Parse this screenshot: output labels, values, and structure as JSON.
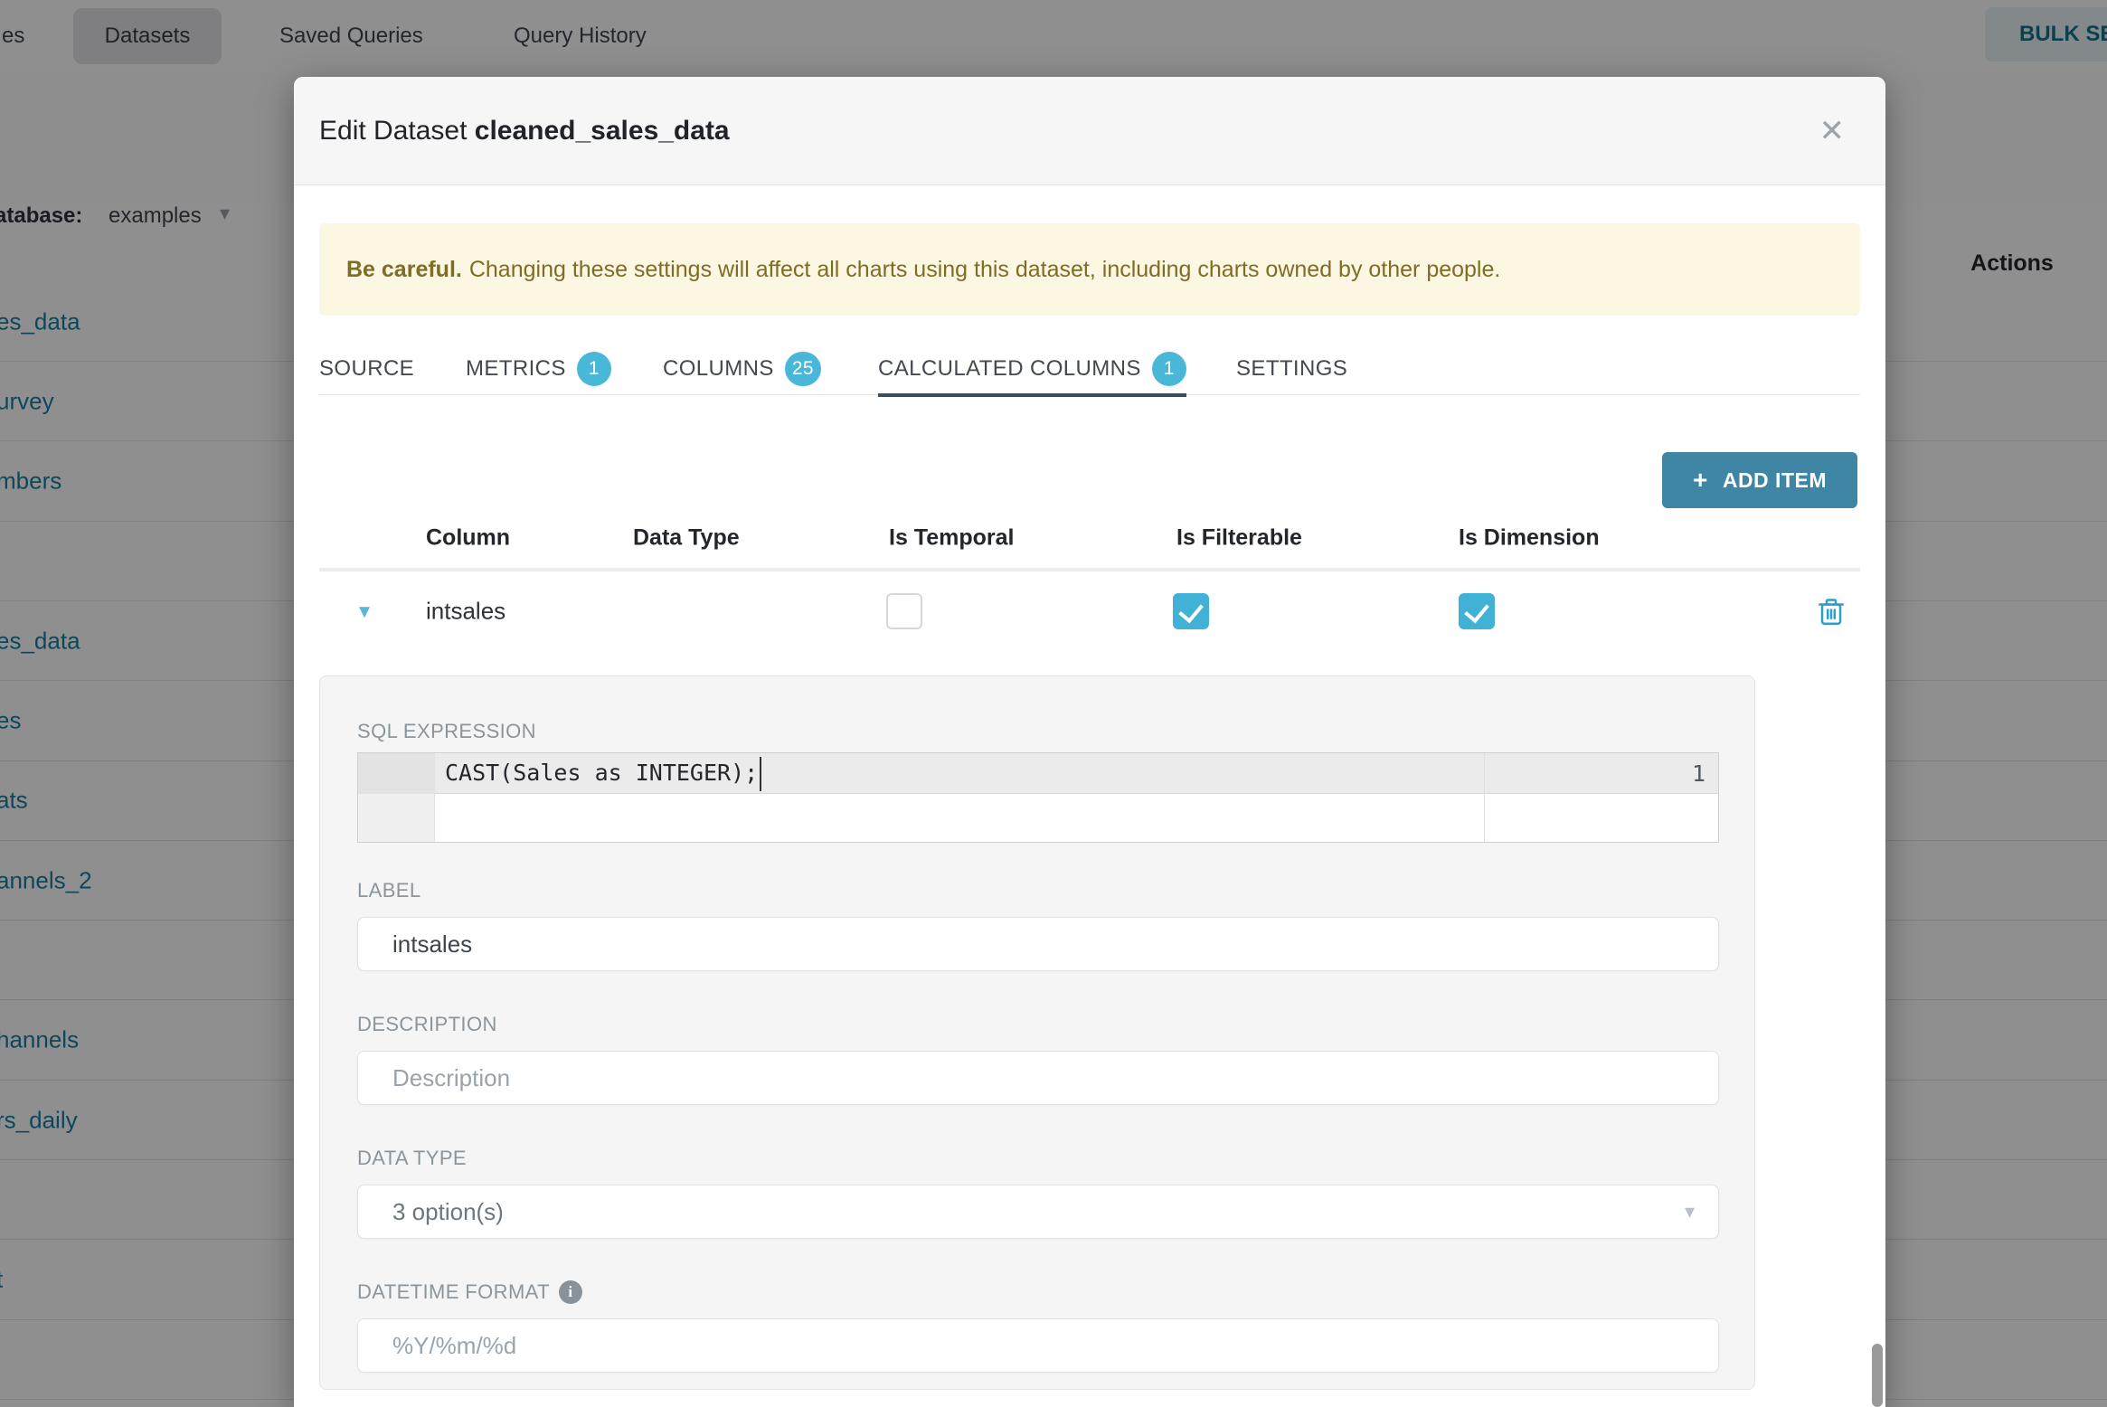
{
  "colors": {
    "primary_button": "#3e86a3",
    "badge": "#49b8d8",
    "checkbox_checked": "#42b1d6",
    "link": "#1a7fa4",
    "active_tab_underline": "#3b4b66",
    "alert_bg": "#fbf7e2",
    "alert_text": "#7e6d24",
    "section_label": "#8b959c"
  },
  "icons": {
    "close": "✕",
    "caret_down": "▾",
    "select_caret": "▾",
    "nav_caret": "▾",
    "plus": "+",
    "info": "i"
  },
  "nav": {
    "left_tab_fragment": "es",
    "datasets_tab": "Datasets",
    "saved_queries_tab": "Saved Queries",
    "query_history_tab": "Query History",
    "bulk_select_label": "BULK SELE"
  },
  "filter_bar": {
    "database_label_fragment": "atabase:",
    "database_value": "examples"
  },
  "background_table": {
    "actions_header": "Actions",
    "rows": [
      "es_data",
      "urvey",
      "mbers",
      "",
      "es_data",
      "es",
      "ats",
      "annels_2",
      "",
      "hannels",
      "rs_daily",
      "",
      "t",
      ""
    ]
  },
  "modal": {
    "title_prefix": "Edit Dataset",
    "title_name": "cleaned_sales_data",
    "alert": {
      "bold": "Be careful.",
      "text": "Changing these settings will affect all charts using this dataset, including charts owned by other people."
    },
    "tabs": [
      {
        "label": "SOURCE"
      },
      {
        "label": "METRICS",
        "badge": "1"
      },
      {
        "label": "COLUMNS",
        "badge": "25"
      },
      {
        "label": "CALCULATED COLUMNS",
        "badge": "1",
        "active": true
      },
      {
        "label": "SETTINGS"
      }
    ],
    "add_item_label": "ADD ITEM",
    "grid": {
      "headers": {
        "column": "Column",
        "data_type": "Data Type",
        "is_temporal": "Is Temporal",
        "is_filterable": "Is Filterable",
        "is_dimension": "Is Dimension"
      },
      "row": {
        "column": "intsales",
        "is_temporal": false,
        "is_filterable": true,
        "is_dimension": true
      }
    },
    "editor": {
      "section_label": "SQL EXPRESSION",
      "line_number": "1",
      "code": "CAST(Sales as INTEGER);"
    },
    "fields": {
      "label": {
        "label": "LABEL",
        "value": "intsales"
      },
      "description": {
        "label": "DESCRIPTION",
        "placeholder": "Description"
      },
      "data_type": {
        "label": "DATA TYPE",
        "value": "3 option(s)"
      },
      "datetime_format": {
        "label": "DATETIME FORMAT",
        "placeholder": "%Y/%m/%d"
      }
    }
  }
}
